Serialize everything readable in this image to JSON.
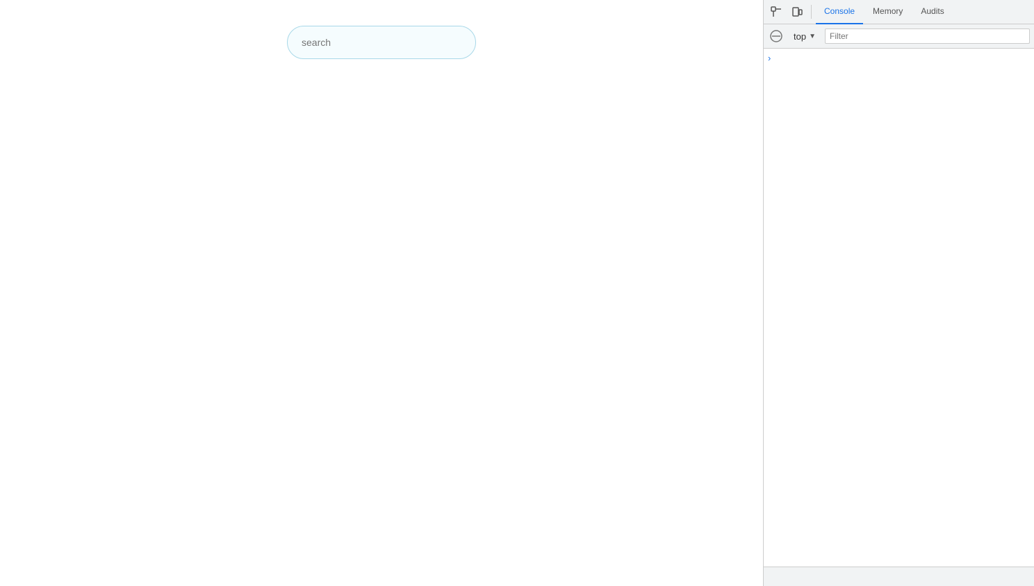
{
  "main": {
    "search_placeholder": "search",
    "search_value": ""
  },
  "devtools": {
    "tabs": [
      {
        "label": "Console",
        "active": true
      },
      {
        "label": "Memory",
        "active": false
      },
      {
        "label": "Audits",
        "active": false
      }
    ],
    "toolbar": {
      "context_label": "top",
      "filter_placeholder": "Filter"
    },
    "icons": {
      "dock": "⊡",
      "screencast": "▭",
      "no_entry": "⊘",
      "dropdown_arrow": "▼",
      "chevron_right": "›"
    }
  }
}
